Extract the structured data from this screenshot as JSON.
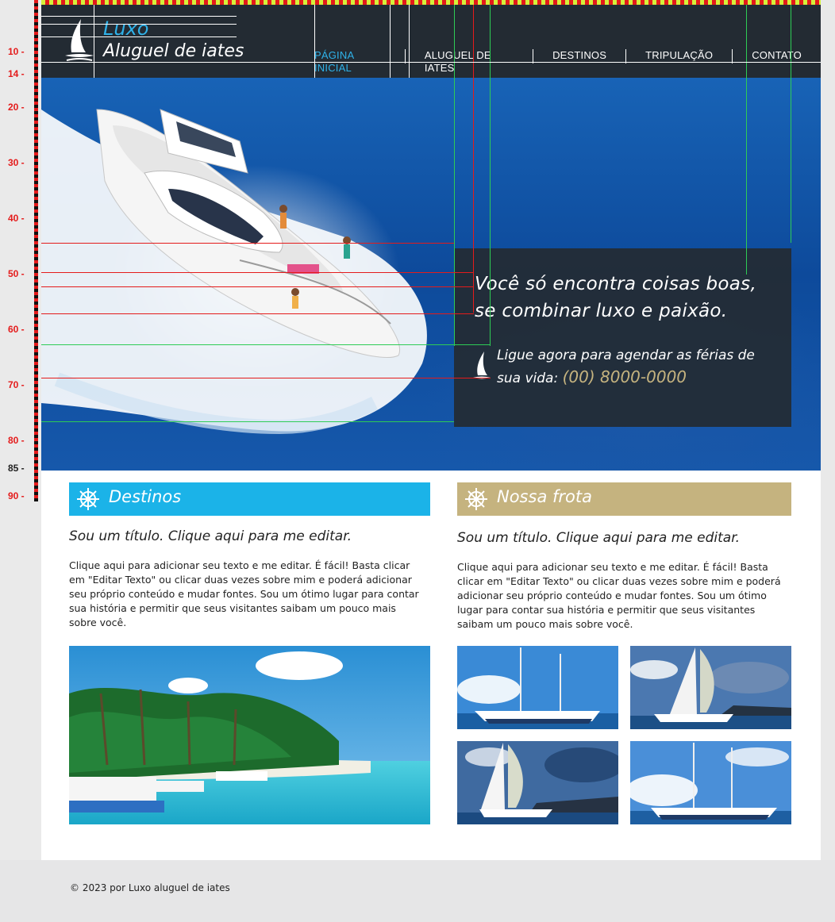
{
  "ruler": {
    "labels": [
      "10 -",
      "14 -",
      "20 -",
      "30 -",
      "40 -",
      "50 -",
      "60 -",
      "70 -",
      "80 -",
      "85 -",
      "90 -"
    ]
  },
  "logo": {
    "line1": "Luxo",
    "line2": "Aluguel de iates"
  },
  "nav": {
    "items": [
      "PÁGINA INICIAL",
      "ALUGUEL DE IATES",
      "DESTINOS",
      "TRIPULAÇÃO",
      "CONTATO"
    ]
  },
  "hero": {
    "headline": "Você só encontra coisas boas, se combinar luxo e paixão.",
    "call_text": "Ligue agora para agendar as férias de sua vida:",
    "phone": "(00) 8000-0000"
  },
  "destinos": {
    "bar_title": "Destinos",
    "title": "Sou um título. Clique aqui para me editar.",
    "body": "Clique aqui para adicionar seu texto e me editar. É fácil! Basta clicar em \"Editar Texto\" ou clicar duas vezes sobre mim e poderá adicionar seu próprio conteúdo e mudar fontes. Sou um ótimo lugar para contar sua história e permitir que seus visitantes saibam um pouco mais sobre você."
  },
  "frota": {
    "bar_title": "Nossa frota",
    "title": "Sou um título. Clique aqui para me editar.",
    "body": "Clique aqui para adicionar seu texto e me editar. É fácil! Basta clicar em \"Editar Texto\" ou clicar duas vezes sobre mim e poderá adicionar seu próprio conteúdo e mudar fontes. Sou um ótimo lugar para contar sua história e permitir que seus visitantes saibam um pouco mais sobre você."
  },
  "footer": {
    "text": "© 2023 por Luxo aluguel de iates"
  },
  "colors": {
    "header_bg": "#232b33",
    "accent_blue": "#1bb3e8",
    "accent_gold": "#c5b37f",
    "guide_red": "#e41b1b",
    "guide_green": "#2ecc55"
  }
}
